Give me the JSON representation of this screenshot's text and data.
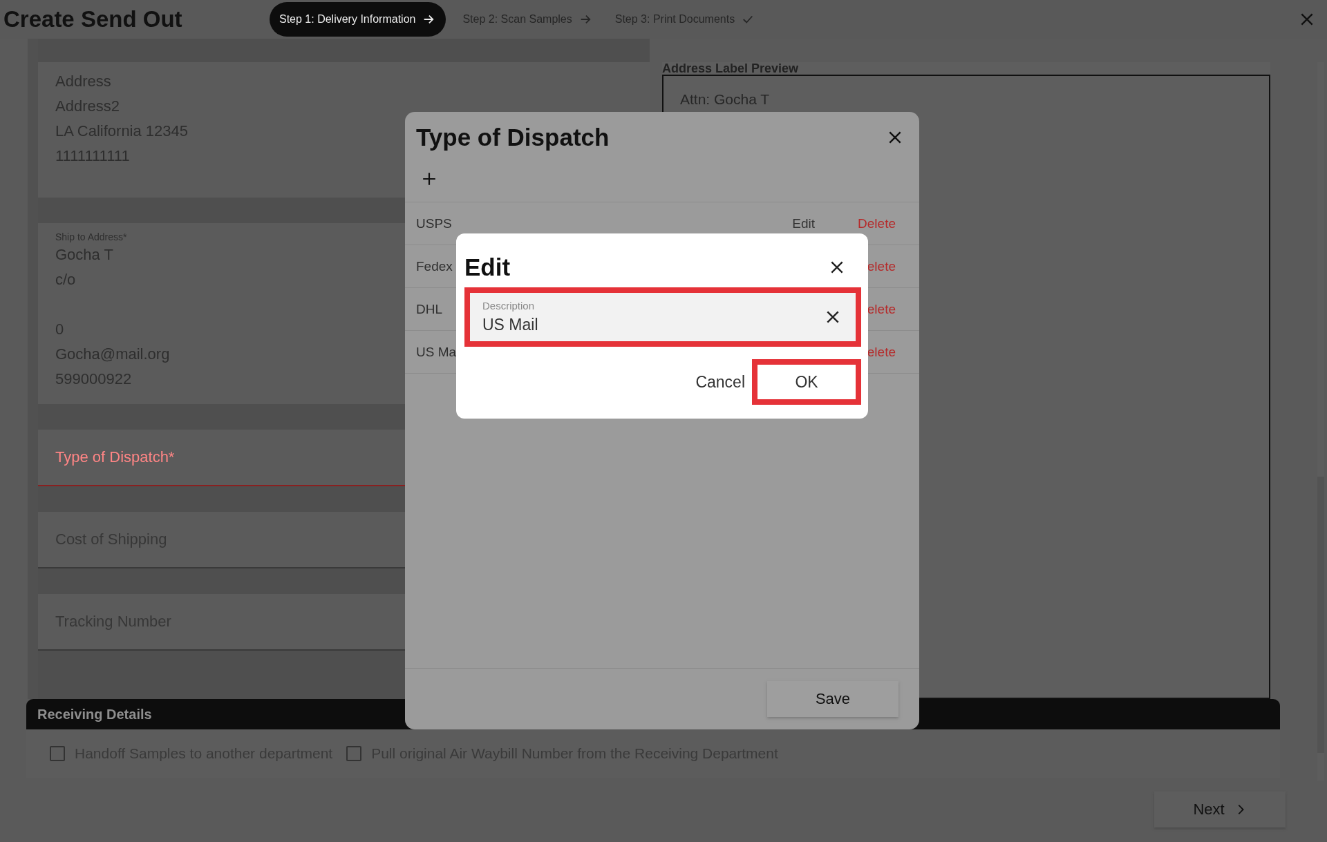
{
  "header": {
    "title": "Create Send Out",
    "steps": [
      {
        "label": "Step 1: Delivery Information",
        "selected": true,
        "kind": "arrow"
      },
      {
        "label": "Step 2: Scan Samples",
        "selected": false,
        "kind": "arrow"
      },
      {
        "label": "Step 3: Print Documents",
        "selected": false,
        "kind": "check"
      }
    ]
  },
  "sender_address": {
    "lines": [
      "Address",
      "Address2",
      "LA California 12345",
      "1111111111"
    ]
  },
  "ship_to": {
    "label": "Ship to Address*",
    "lines": [
      "Gocha T",
      "c/o",
      "0",
      "Gocha@mail.org",
      "599000922"
    ]
  },
  "fields": [
    {
      "label": "Type of Dispatch*",
      "invalid": true
    },
    {
      "label": "Cost of Shipping",
      "invalid": false
    },
    {
      "label": "Tracking Number",
      "invalid": false
    }
  ],
  "preview": {
    "title": "Address Label Preview",
    "lines": [
      "Attn: Gocha T"
    ]
  },
  "receiving": {
    "title": "Receiving Details",
    "options": [
      {
        "label": "Handoff Samples to another department",
        "checked": false
      },
      {
        "label": "Pull original Air Waybill Number from the Receiving Department",
        "checked": false
      }
    ]
  },
  "next_button": "Next",
  "dispatch_dialog": {
    "title": "Type of Dispatch",
    "items": [
      {
        "name": "USPS",
        "edit": "Edit",
        "delete": "Delete"
      },
      {
        "name": "Fedex",
        "delete": "elete"
      },
      {
        "name": "DHL",
        "delete": "elete"
      },
      {
        "name": "US Ma",
        "delete": "elete"
      }
    ],
    "save": "Save"
  },
  "edit_dialog": {
    "title": "Edit",
    "field": {
      "label": "Description",
      "value": "US Mail",
      "highlighted": true
    },
    "buttons": [
      {
        "label": "Cancel",
        "highlighted": false
      },
      {
        "label": "OK",
        "highlighted": true
      }
    ]
  }
}
